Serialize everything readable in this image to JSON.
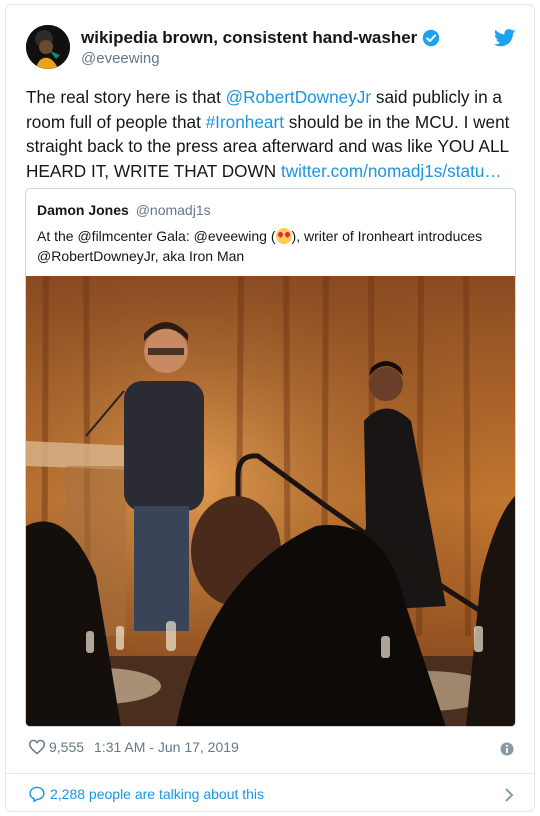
{
  "author": {
    "name": "wikipedia brown, consistent hand-washer",
    "handle": "@eveewing",
    "verified": true
  },
  "tweet": {
    "text_part1": "The real story here is that ",
    "mention1": "@RobertDowneyJr",
    "text_part2": " said publicly in a room full of people that ",
    "hashtag": "#Ironheart",
    "text_part3": " should be in the MCU. I went straight back to the press area afterward and was like YOU ALL HEARD IT, WRITE THAT DOWN ",
    "link": "twitter.com/nomadj1s/statu…"
  },
  "quoted": {
    "name": "Damon Jones",
    "handle": "@nomadj1s",
    "text_before_emoji": "At the @filmcenter Gala: @eveewing (",
    "text_after_emoji": "), writer of Ironheart introduces @RobertDowneyJr, aka Iron Man",
    "emoji": "heart-eyes-emoji"
  },
  "footer": {
    "likes": "9,555",
    "timestamp": "1:31 AM - Jun 17, 2019",
    "talking": "2,288 people are talking about this"
  },
  "colors": {
    "link": "#1b95e0",
    "secondary_text": "#657786",
    "border": "#e1e8ed"
  }
}
